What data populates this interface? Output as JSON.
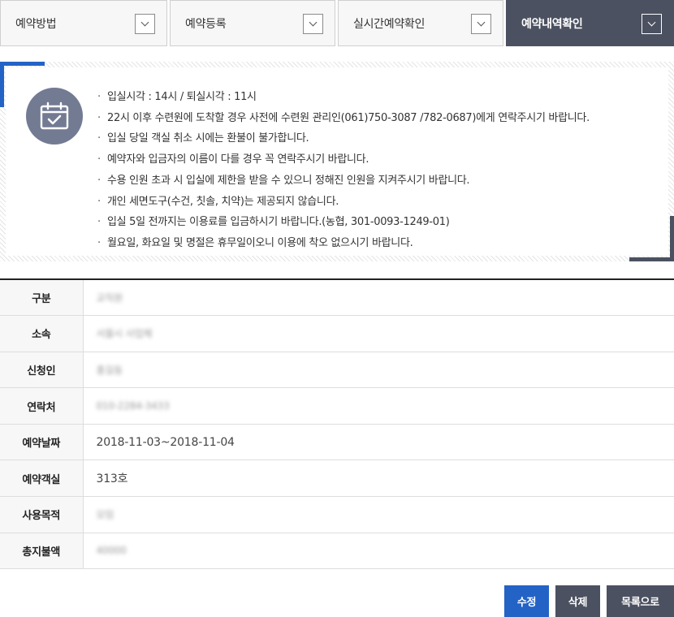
{
  "tabs": [
    {
      "label": "예약방법",
      "active": false
    },
    {
      "label": "예약등록",
      "active": false
    },
    {
      "label": "실시간예약확인",
      "active": false
    },
    {
      "label": "예약내역확인",
      "active": true
    }
  ],
  "colors": {
    "accent_blue": "#2463c6",
    "dark_slate": "#4b5160",
    "icon_circle": "#737b93"
  },
  "notice": {
    "icon": "calendar-check-icon",
    "items": [
      "입실시각 : 14시 / 퇴실시각 : 11시",
      "22시 이후 수련원에 도착할 경우 사전에 수련원 관리인(061)750-3087 /782-0687)에게 연락주시기 바랍니다.",
      "입실 당일 객실 취소 시에는 환불이 불가합니다.",
      "예약자와 입금자의 이름이 다를 경우 꼭 연락주시기 바랍니다.",
      "수용 인원 초과 시 입실에 제한을 받을 수 있으니 정해진 인원을 지켜주시기 바랍니다.",
      "개인 세면도구(수건, 칫솔, 치약)는 제공되지 않습니다.",
      "입실 5일 전까지는 이용료를 입금하시기 바랍니다.(농협, 301-0093-1249-01)",
      "월요일, 화요일 및 명절은 휴무일이오니 이용에 착오 없으시기 바랍니다."
    ]
  },
  "info": {
    "rows": [
      {
        "label": "구분",
        "value": "교직원",
        "blurred": true
      },
      {
        "label": "소속",
        "value": "서울시 사업체",
        "blurred": true
      },
      {
        "label": "신청인",
        "value": "홍길동",
        "blurred": true
      },
      {
        "label": "연락처",
        "value": "010-2284-3433",
        "blurred": true
      },
      {
        "label": "예약날짜",
        "value": "2018-11-03~2018-11-04",
        "blurred": false
      },
      {
        "label": "예약객실",
        "value": "313호",
        "blurred": false
      },
      {
        "label": "사용목적",
        "value": "모임",
        "blurred": true
      },
      {
        "label": "총지불액",
        "value": "40000",
        "blurred": true
      }
    ]
  },
  "buttons": {
    "edit": "수정",
    "delete": "삭제",
    "list": "목록으로"
  }
}
